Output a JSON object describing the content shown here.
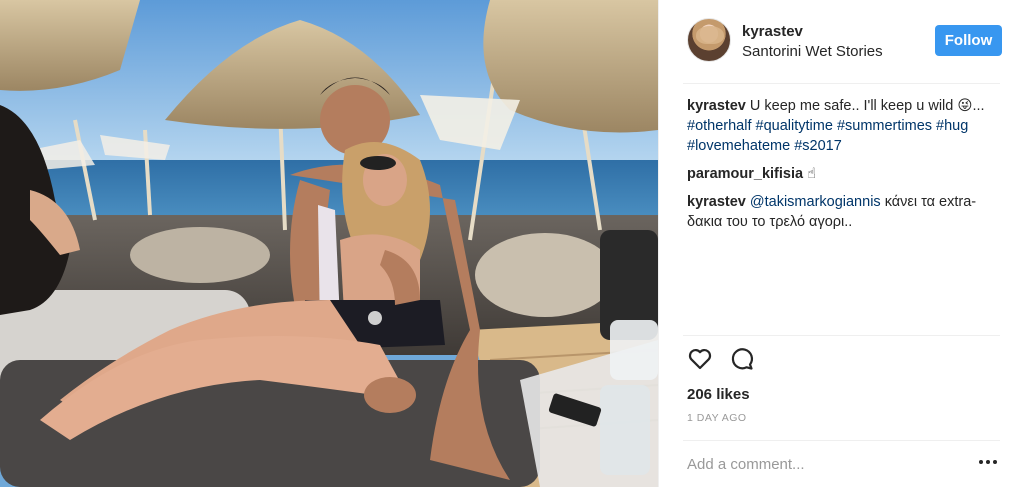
{
  "header": {
    "username": "kyrastev",
    "location": "Santorini Wet Stories",
    "follow_label": "Follow"
  },
  "caption": {
    "username": "kyrastev",
    "text": "U keep me safe.. I'll keep u wild 😜...",
    "hashtags": [
      "#otherhalf",
      "#qualitytime",
      "#summertimes",
      "#hug",
      "#lovemehateme",
      "#s2017"
    ]
  },
  "comments": [
    {
      "username": "paramour_kifisia",
      "text": "☝",
      "mention": ""
    },
    {
      "username": "kyrastev",
      "mention": "@takismarkogiannis",
      "text": "κάνει τα extra-δακια του το τρελό αγορι.."
    }
  ],
  "actions": {
    "like_icon": "heart-outline-icon",
    "comment_icon": "speech-bubble-icon"
  },
  "likes": "206 likes",
  "timestamp": "1 DAY AGO",
  "add_comment": {
    "placeholder": "Add a comment..."
  },
  "more_icon": "ellipsis-icon",
  "colors": {
    "follow_button": "#3897f0",
    "hashtag": "#003569",
    "secondary_text": "#999999",
    "divider": "#efefef"
  }
}
